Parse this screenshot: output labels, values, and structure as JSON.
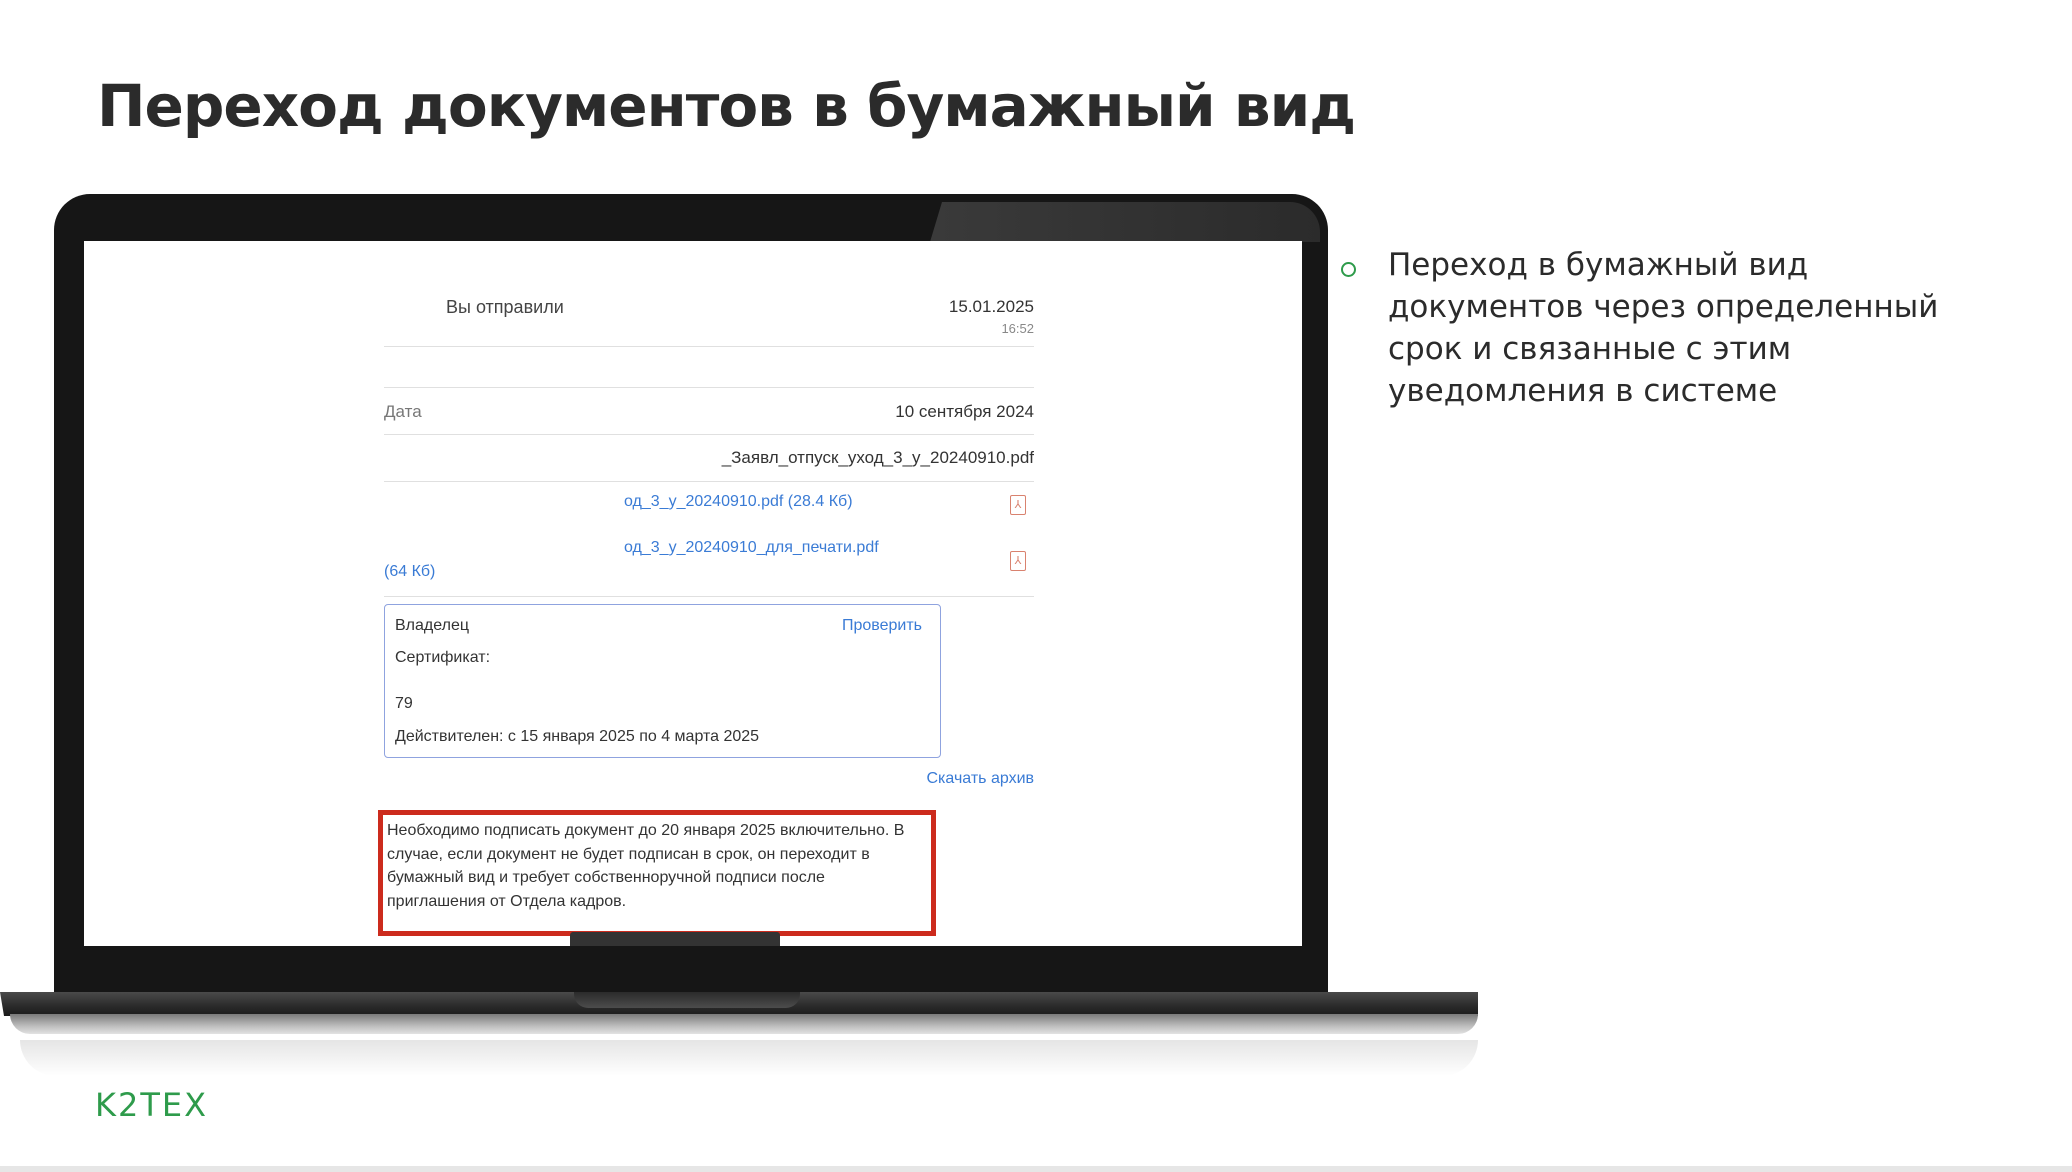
{
  "slide": {
    "title": "Переход документов в бумажный вид",
    "bullet": "Переход в бумажный вид документов через определенный срок и связанные с этим уведомления в системе",
    "logo": "K2TEX",
    "colors": {
      "accent": "#2e9b4b",
      "highlight_border": "#cc2b1d",
      "link": "#3a7bd5"
    }
  },
  "screen": {
    "sent_label": "Вы отправили",
    "sent_date": "15.01.2025",
    "sent_time": "16:52",
    "date_label": "Дата",
    "date_value": "10 сентября 2024",
    "file_name": "_Заявл_отпуск_уход_3_у_20240910.pdf",
    "attachments": [
      {
        "link_text": "од_3_у_20240910.pdf  (28.4 Кб)",
        "icon": "pdf-icon"
      },
      {
        "link_text": "од_3_у_20240910_для_печати.pdf",
        "size_text": "(64 Кб)",
        "icon": "pdf-icon"
      }
    ],
    "certificate": {
      "owner_label": "Владелец",
      "check_link": "Проверить",
      "cert_label": "Сертификат:",
      "cert_number": "79",
      "validity": "Действителен: с 15 января 2025 по 4 марта 2025"
    },
    "download_link": "Скачать архив",
    "warning_text": "Необходимо подписать документ до 20 января 2025 включительно. В случае, если документ не будет подписан в срок, он переходит в бумажный вид и требует собственноручной подписи после приглашения от Отдела кадров."
  }
}
